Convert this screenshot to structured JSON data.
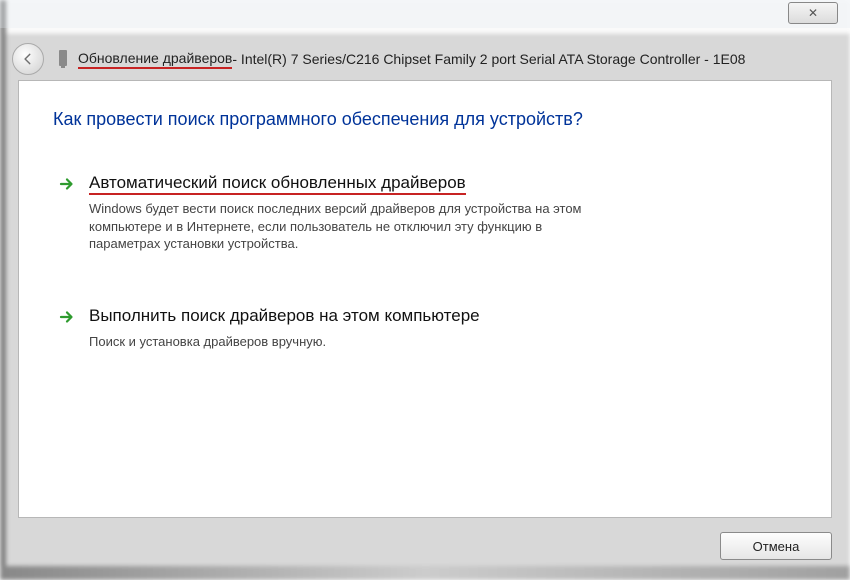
{
  "titlebar": {
    "close_symbol": "✕"
  },
  "header": {
    "highlight_text": "Обновление драйверов",
    "rest_text": " - Intel(R) 7 Series/C216 Chipset Family 2 port Serial ATA Storage Controller - 1E08"
  },
  "content": {
    "heading": "Как провести поиск программного обеспечения для устройств?",
    "options": [
      {
        "title": "Автоматический поиск обновленных драйверов",
        "desc": "Windows будет вести поиск последних версий драйверов для устройства на этом компьютере и в Интернете, если пользователь не отключил эту функцию в параметрах установки устройства.",
        "highlighted": true
      },
      {
        "title": "Выполнить поиск драйверов на этом компьютере",
        "desc": "Поиск и установка драйверов вручную.",
        "highlighted": false
      }
    ]
  },
  "footer": {
    "cancel_label": "Отмена"
  }
}
